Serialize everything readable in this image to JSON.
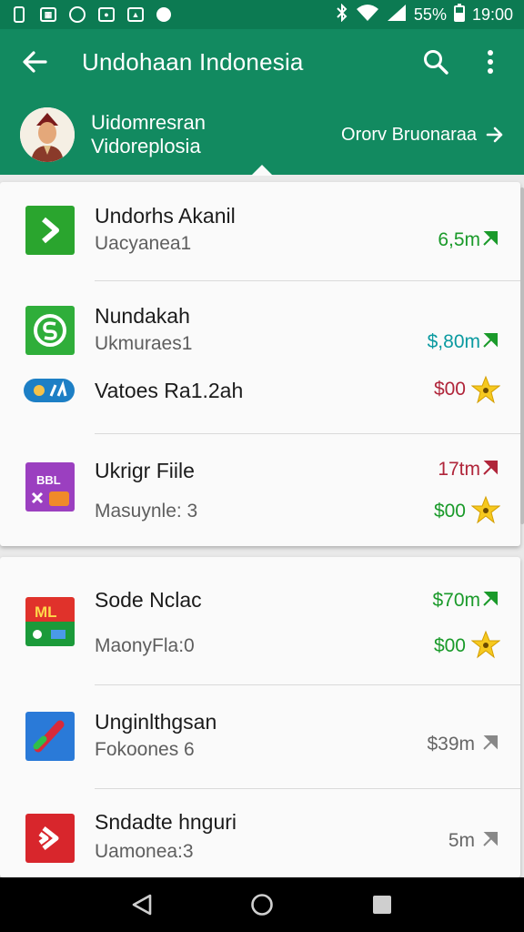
{
  "status_bar": {
    "battery": "55%",
    "time": "19:00"
  },
  "app_bar": {
    "title": "Undohaan Indonesia"
  },
  "profile": {
    "line1": "Uidomresran",
    "line2": "Vidoreplosia",
    "link": "Ororv Bruonaraa"
  },
  "colors": {
    "primary": "#128a60",
    "primary_dark": "#0c7a52",
    "green": "#1a9a2a",
    "red": "#b0253a",
    "teal": "#0a9aa0",
    "gray": "#666666"
  },
  "items": [
    {
      "title": "Undorhs Akanil",
      "sub": "Uacyanea1",
      "value": "6,5m",
      "trend": "up",
      "icon": "arrow-app-icon"
    },
    {
      "title": "Nundakah",
      "sub": "Ukmuraes1",
      "value": "$,80m",
      "trend": "up",
      "icon": "s-app-icon"
    },
    {
      "title": "Vatoes Ra1.2ah",
      "value": "$00",
      "badge": "star",
      "icon": "pill-app-icon"
    },
    {
      "title": "Ukrigr Fiile",
      "sub": "Masuynle: 3",
      "value": "17tm",
      "value2": "$00",
      "trend": "up",
      "badge": "star",
      "icon": "grid-app-icon"
    },
    {
      "title": "Sode Nclac",
      "sub": "MaonyFla:0",
      "value": "$70m",
      "value2": "$00",
      "trend": "up",
      "badge": "star",
      "icon": "ml-app-icon"
    },
    {
      "title": "Unginlthgsan",
      "sub": "Fokoones 6",
      "value": "$39m",
      "trend": "up",
      "icon": "tools-app-icon"
    },
    {
      "title": "Sndadte hnguri",
      "sub": "Uamonea:3",
      "value": "5m",
      "trend": "up",
      "icon": "play-app-icon"
    }
  ]
}
